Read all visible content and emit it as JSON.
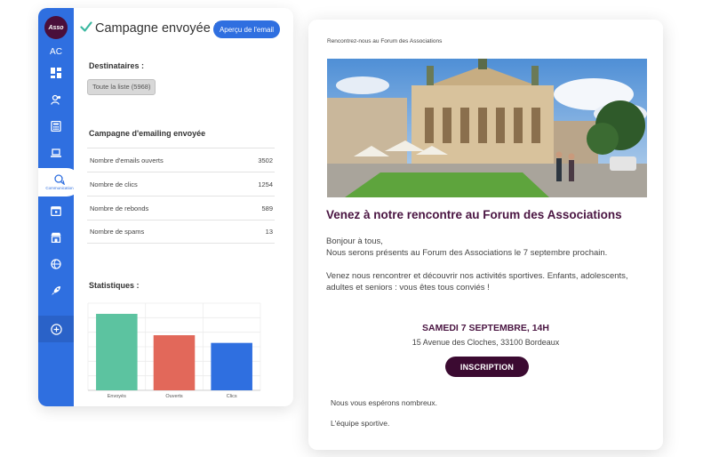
{
  "sidebar": {
    "logo_text": "Asso",
    "initials": "AC",
    "active_label": "Communication"
  },
  "header": {
    "title": "Campagne envoyée !",
    "preview_button": "Aperçu de l'email"
  },
  "recipients": {
    "label": "Destinataires :",
    "list_chip": "Toute la liste (5968)"
  },
  "campaign": {
    "label": "Campagne d'emailing envoyée",
    "rows": [
      {
        "label": "Nombre d'emails ouverts",
        "value": "3502"
      },
      {
        "label": "Nombre de clics",
        "value": "1254"
      },
      {
        "label": "Nombre de rebonds",
        "value": "589"
      },
      {
        "label": "Nombre de spams",
        "value": "13"
      }
    ]
  },
  "statistics": {
    "label": "Statistiques :"
  },
  "chart_data": {
    "type": "bar",
    "categories": [
      "Envoyés",
      "Ouverts",
      "Clics"
    ],
    "values": [
      5968,
      4300,
      3700
    ],
    "colors": [
      "#5cc3a0",
      "#e2685a",
      "#2f6fe0"
    ],
    "ylim": [
      0,
      6800
    ],
    "grid": true,
    "title": "",
    "xlabel": "",
    "ylabel": ""
  },
  "email": {
    "header_text": "Rencontrez-nous au Forum des Associations",
    "title": "Venez à notre rencontre au Forum des Associations",
    "greeting": "Bonjour à tous,",
    "intro": "Nous serons présents au Forum des Associations le 7 septembre prochain.",
    "body": "Venez nous rencontrer et découvrir nos activités sportives. Enfants, adolescents, adultes et seniors : vous êtes tous conviés !",
    "event_date": "SAMEDI 7 SEPTEMBRE, 14H",
    "event_address": "15 Avenue des Cloches, 33100 Bordeaux",
    "cta": "INSCRIPTION",
    "closing": "Nous vous espérons nombreux.",
    "signature": "L'équipe sportive."
  },
  "colors": {
    "primary": "#2f6fe0",
    "brand_dark": "#3b0a31",
    "title_purple": "#4a1542",
    "success": "#3bb8a0"
  }
}
